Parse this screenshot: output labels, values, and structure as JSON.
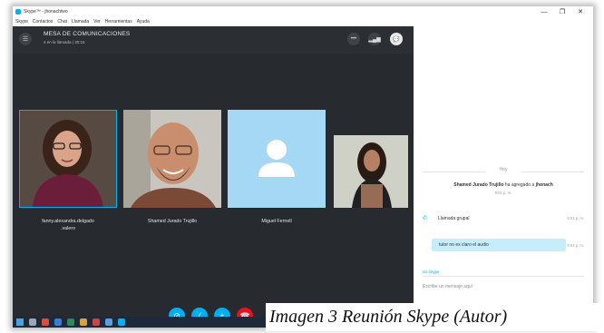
{
  "window": {
    "title": "Skype™ - jhonachtwo",
    "controls": {
      "minimize": "—",
      "maximize": "❐",
      "close": "✕"
    }
  },
  "menu": [
    "Skype",
    "Contactos",
    "Chat",
    "Llamada",
    "Ver",
    "Herramientas",
    "Ayuda"
  ],
  "call": {
    "title": "MESA DE COMUNICACIONES",
    "subtitle": "4 en la llamada | 30:16",
    "header_icons": [
      "more-icon",
      "signal-icon",
      "chat-icon"
    ],
    "participants": [
      {
        "name_line1": "fanny.alexandra.delgado",
        "name_line2": ".valero",
        "type": "video",
        "active": true
      },
      {
        "name_line1": "Shamed Jurado Trujillo",
        "name_line2": "",
        "type": "video",
        "active": false
      },
      {
        "name_line1": "Miguel Fernell",
        "name_line2": "",
        "type": "avatar",
        "active": false
      },
      {
        "name_line1": "",
        "name_line2": "",
        "type": "self-video",
        "active": false
      }
    ],
    "controls": [
      {
        "icon": "video-off-icon",
        "color": "#00aff0"
      },
      {
        "icon": "mic-off-icon",
        "color": "#00aff0"
      },
      {
        "icon": "add-icon",
        "color": "#00aff0"
      },
      {
        "icon": "hang-up-icon",
        "color": "#e81123"
      }
    ]
  },
  "chat": {
    "day_label": "Hoy",
    "system_message": {
      "actor": "Shamed Jurado Trujillo",
      "text": "ha agregado a",
      "target": "jhonach",
      "time": "9:01 p. m."
    },
    "call_entry": {
      "label": "Llamada grupal",
      "time": "9:01 p. m."
    },
    "message": {
      "text": "tutor no es claro el audio",
      "time": "9:04 p. m."
    },
    "via": "vía Skype",
    "compose_placeholder": "Escribe un mensaje aquí"
  },
  "caption": "Imagen 3  Reunión Skype (Autor)",
  "colors": {
    "accent": "#00aff0",
    "call_bg": "#272b2f",
    "hangup": "#e81123",
    "bubble": "#c7edfc"
  }
}
